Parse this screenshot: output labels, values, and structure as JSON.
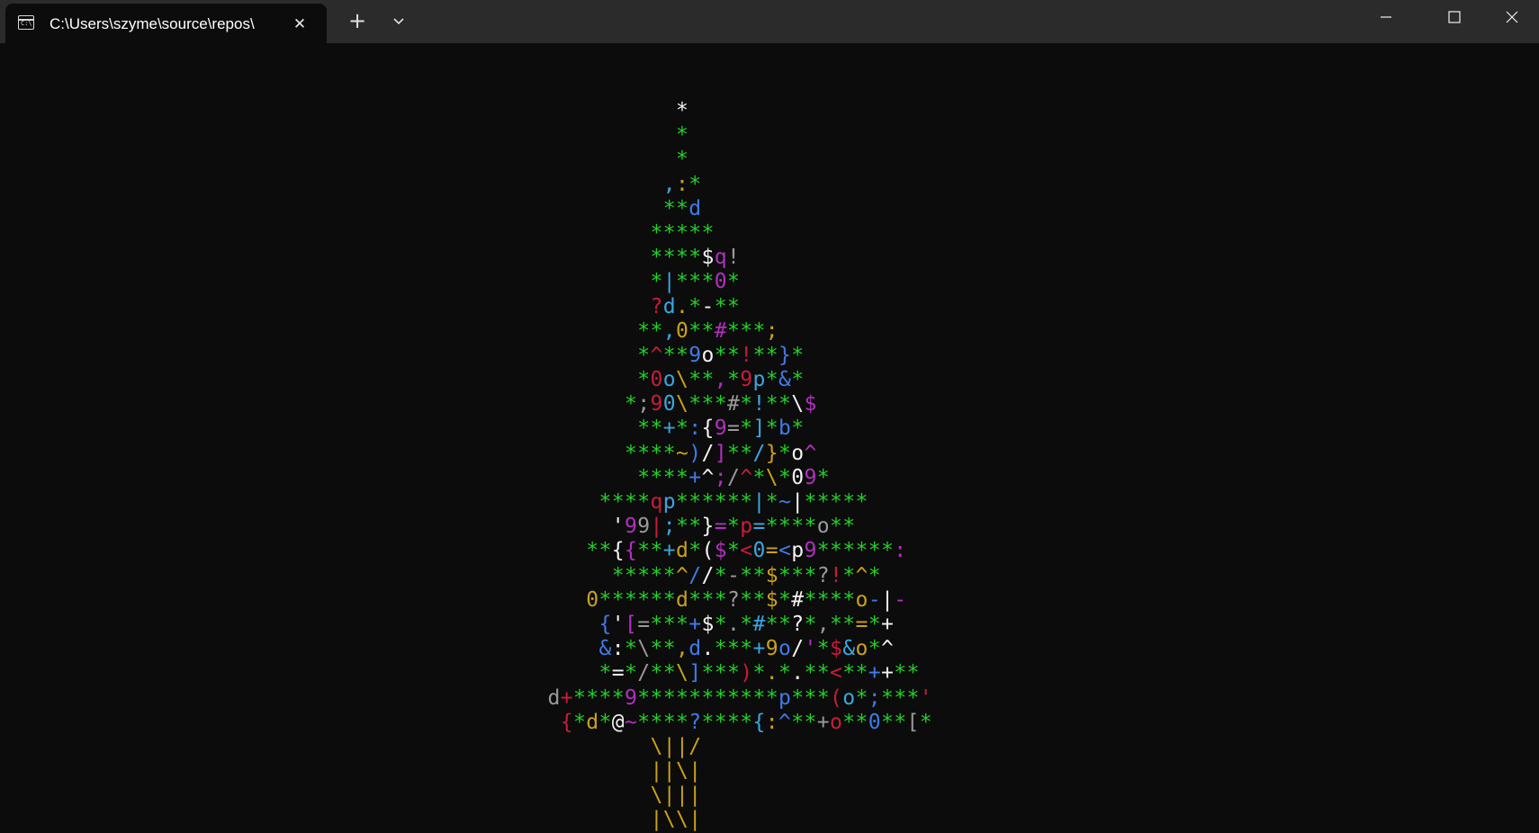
{
  "window": {
    "tab_title": "C:\\Users\\szyme\\source\\repos\\",
    "tab_close_glyph": "✕",
    "new_tab_glyph": "+",
    "icons": [
      "terminal-icon",
      "close-icon",
      "plus-icon",
      "chevron-down-icon",
      "minimize-icon",
      "maximize-icon",
      "close-window-icon"
    ]
  },
  "colors": {
    "background": "#0c0c0c",
    "titlebar": "#2b2b2b",
    "green": "#23d12a",
    "white": "#f2f2f2",
    "yellow": "#c9a21a",
    "red": "#c91b3a",
    "magenta": "#b22fc0",
    "blue": "#3f7be8",
    "cyan": "#3aa6e0",
    "gray": "#9a9a9a"
  },
  "terminal": {
    "tree_lines": [
      "            *",
      "            *",
      "            *",
      "           ,:*",
      "           **d",
      "          *****",
      "          ****$q!",
      "          *|***0*",
      "          ?d.*-**",
      "         **,0**#***;",
      "         *^**9o**!**}*",
      "         *0o\\**,*9p*&*",
      "        *;90\\***#*!**\\$",
      "         **+*:{9=*]*b*",
      "        ****~)/]**/}*o^",
      "         ****+^;/^*\\*09*",
      "      ****qp******|*~|*****",
      "       '99|;**}=*p=****o**",
      "     **{{**+d*($*<0=<p9******:",
      "       *****^//*-**$***?!*^*",
      "     0******d***?**$*#****o-|-",
      "      {'[=***+$*.*#**?*,**=*+",
      "      &:*\\**,d.***+9o/'*$&o*^",
      "      *=*/**\\]***)*.*.**<**++**",
      "  d+****9***********p***(o*;***'",
      "   {*d*@~****?****{:^**+o**0**[*",
      "          \\||/",
      "          ||\\|",
      "          \\|||",
      "          |\\\\|"
    ]
  }
}
